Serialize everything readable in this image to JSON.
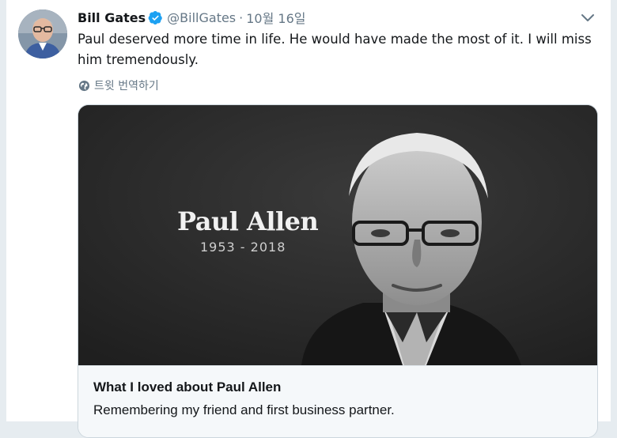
{
  "tweet": {
    "display_name": "Bill Gates",
    "verified": true,
    "handle": "@BillGates",
    "separator": "·",
    "timestamp": "10월 16일",
    "text": "Paul deserved more time in life. He would have made the most of it. I will miss him tremendously.",
    "translate_label": "트윗 번역하기"
  },
  "card": {
    "image_title": "Paul Allen",
    "image_years": "1953 - 2018",
    "title": "What I loved about Paul Allen",
    "description": "Remembering my friend and first business partner."
  },
  "icons": {
    "verified": "verified-badge-icon",
    "caret": "chevron-down-icon",
    "translate": "globe-icon"
  },
  "colors": {
    "accent": "#1da1f2",
    "secondary_text": "#657786",
    "primary_text": "#14171a",
    "page_background": "#e6ecf0",
    "card_background": "#f5f8fa"
  }
}
